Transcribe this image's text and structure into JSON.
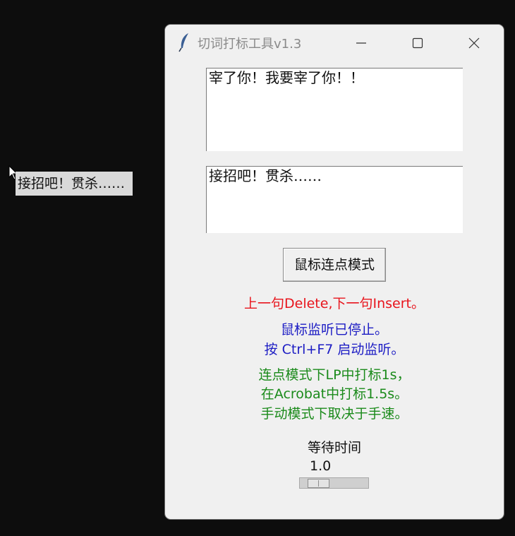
{
  "tooltip": {
    "text": "接招吧！贯杀……"
  },
  "window": {
    "title": "切词打标工具v1.3",
    "icon": "feather-icon",
    "controls": [
      "minimize-icon",
      "maximize-icon",
      "close-icon"
    ]
  },
  "text_area_1": {
    "value": "宰了你！我要宰了你！！"
  },
  "text_area_2": {
    "value": "接招吧！贯杀……"
  },
  "mode_button": {
    "label": "鼠标连点模式"
  },
  "info": {
    "hotkeys": "上一句Delete,下一句Insert。",
    "listen_status": "鼠标监听已停止。",
    "listen_hint": "按 Ctrl+F7 启动监听。",
    "tip_line1": "连点模式下LP中打标1s，",
    "tip_line2": "在Acrobat中打标1.5s。",
    "tip_line3": "手动模式下取决于手速。"
  },
  "wait": {
    "label": "等待时间",
    "value": "1.0"
  },
  "colors": {
    "red": "#e8141c",
    "blue": "#1c1cc4",
    "green": "#1a8a1a",
    "background": "#0d0d0d",
    "window": "#f0f0f0"
  }
}
